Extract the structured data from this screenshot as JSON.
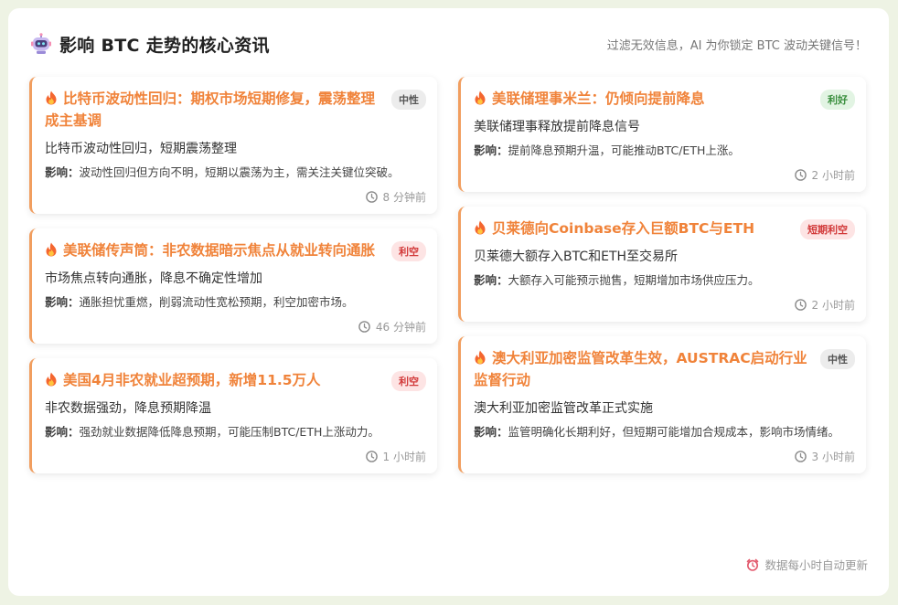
{
  "header": {
    "title": "影响 BTC 走势的核心资讯",
    "subtitle": "过滤无效信息，AI 为你锁定 BTC 波动关键信号！"
  },
  "impact_label": "影响：",
  "left_cards": [
    {
      "title": "比特币波动性回归：期权市场短期修复，震荡整理成主基调",
      "badge": "中性",
      "badge_type": "neutral",
      "summary": "比特币波动性回归，短期震荡整理",
      "impact": "波动性回归但方向不明，短期以震荡为主，需关注关键位突破。",
      "time": "8 分钟前"
    },
    {
      "title": "美联储传声筒：非农数据暗示焦点从就业转向通胀",
      "badge": "利空",
      "badge_type": "bad",
      "summary": "市场焦点转向通胀，降息不确定性增加",
      "impact": "通胀担忧重燃，削弱流动性宽松预期，利空加密市场。",
      "time": "46 分钟前"
    },
    {
      "title": "美国4月非农就业超预期，新增11.5万人",
      "badge": "利空",
      "badge_type": "bad",
      "summary": "非农数据强劲，降息预期降温",
      "impact": "强劲就业数据降低降息预期，可能压制BTC/ETH上涨动力。",
      "time": "1 小时前"
    }
  ],
  "right_cards": [
    {
      "title": "美联储理事米兰：仍倾向提前降息",
      "badge": "利好",
      "badge_type": "good",
      "summary": "美联储理事释放提前降息信号",
      "impact": "提前降息预期升温，可能推动BTC/ETH上涨。",
      "time": "2 小时前"
    },
    {
      "title": "贝莱德向Coinbase存入巨额BTC与ETH",
      "badge": "短期利空",
      "badge_type": "bad",
      "summary": "贝莱德大额存入BTC和ETH至交易所",
      "impact": "大额存入可能预示抛售，短期增加市场供应压力。",
      "time": "2 小时前"
    },
    {
      "title": "澳大利亚加密监管改革生效，AUSTRAC启动行业监督行动",
      "badge": "中性",
      "badge_type": "neutral",
      "summary": "澳大利亚加密监管改革正式实施",
      "impact": "监管明确化长期利好，但短期可能增加合规成本，影响市场情绪。",
      "time": "3 小时前"
    }
  ],
  "footer": {
    "text": "数据每小时自动更新"
  },
  "colors": {
    "accent": "#f0833a",
    "card_border": "#f19e5f",
    "good": "#3a8f3e",
    "bad": "#d23a3a",
    "neutral": "#555555"
  }
}
